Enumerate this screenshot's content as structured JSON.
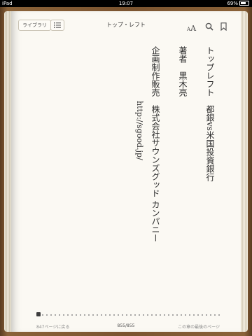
{
  "status_bar": {
    "left": "iPad",
    "time": "19:07",
    "battery": "69%"
  },
  "toolbar": {
    "library_label": "ライブラリ",
    "title": "トップ・レフト",
    "font_small": "A",
    "font_big": "A"
  },
  "content": {
    "line1": "トップレフト　都銀vs米国投資銀行",
    "line2": "著者　黒木亮",
    "line3": "企画制作販売　株式会社サウンズグッド カンパニー",
    "line4": "http://sgood.jp/"
  },
  "footer": {
    "back_label": "847ページに戻る",
    "page_counter": "855/855",
    "chapter_remaining": "この章の最後のページ",
    "progress_fraction": 0.01
  }
}
